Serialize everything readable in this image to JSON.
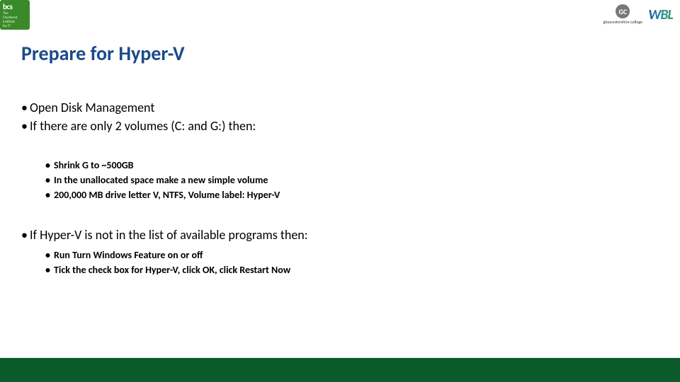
{
  "logos": {
    "bcs_text": "bcs",
    "bcs_sub1": "The",
    "bcs_sub2": "Chartered",
    "bcs_sub3": "Institute",
    "bcs_sub4": "for IT",
    "gc_initials": "GC",
    "gc_text": "gloucestershire college",
    "wbl": "WBL"
  },
  "title": "Prepare for Hyper-V",
  "bullets": {
    "p1": "Open Disk Management",
    "p2": "If there are only 2 volumes (C: and G:) then:",
    "s1": "Shrink G to ~500GB",
    "s2": "In the unallocated space make a new simple volume",
    "s3": "200,000 MB drive letter V, NTFS, Volume label: Hyper-V",
    "p3": "If Hyper-V is not in the list of available programs then:",
    "s4": "Run Turn Windows Feature on or off",
    "s5": "Tick the check box for Hyper-V, click OK, click Restart Now"
  },
  "glyphs": {
    "bullet": "•"
  }
}
